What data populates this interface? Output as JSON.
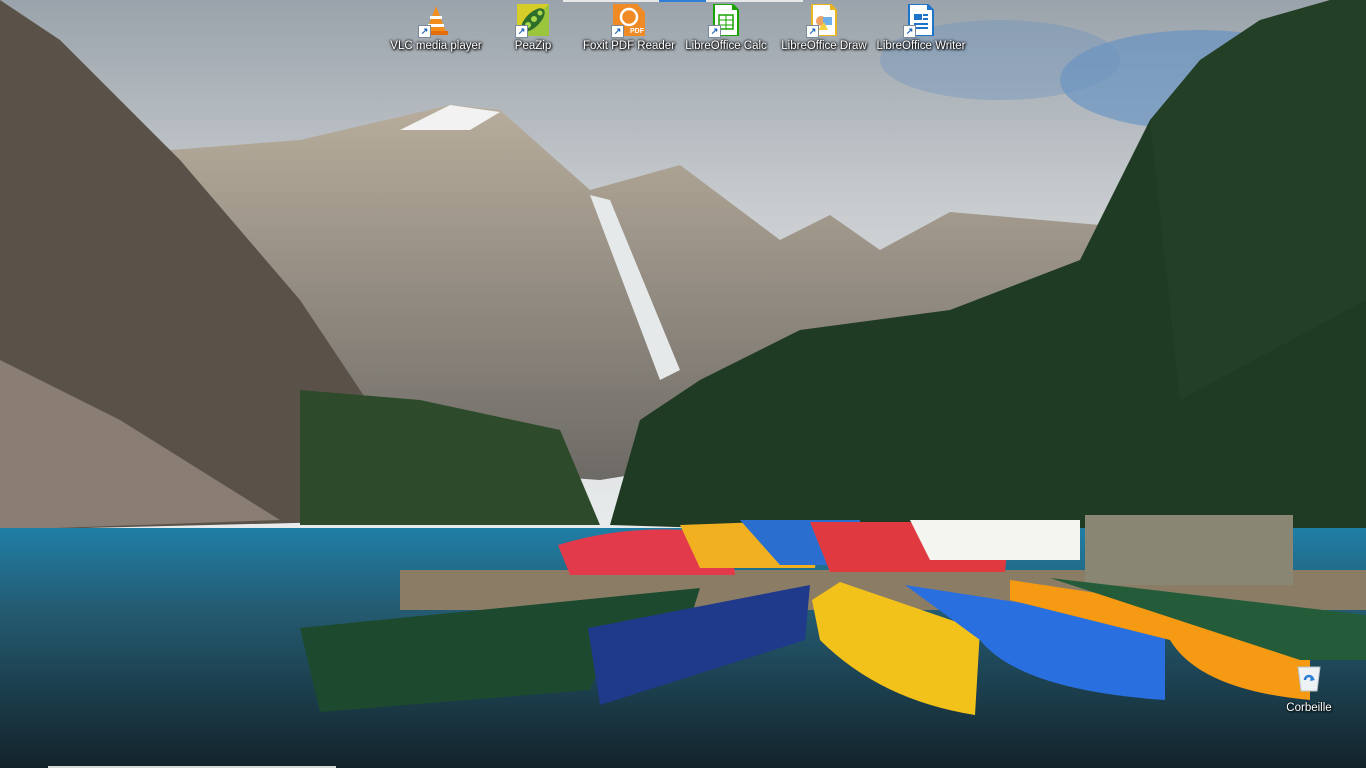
{
  "desktop": {
    "icons": [
      {
        "label": "VLC media player",
        "icon": "vlc-cone-icon"
      },
      {
        "label": "PeaZip",
        "icon": "peazip-icon"
      },
      {
        "label": "Foxit PDF Reader",
        "icon": "foxit-pdf-icon"
      },
      {
        "label": "LibreOffice Calc",
        "icon": "libreoffice-calc-icon"
      },
      {
        "label": "LibreOffice Draw",
        "icon": "libreoffice-draw-icon"
      },
      {
        "label": "LibreOffice Writer",
        "icon": "libreoffice-writer-icon"
      }
    ],
    "recycle_bin": {
      "label": "Corbeille",
      "icon": "recycle-bin-icon"
    },
    "foxit_badge": "PDF"
  },
  "colors": {
    "accent": "#2f7fd6"
  }
}
